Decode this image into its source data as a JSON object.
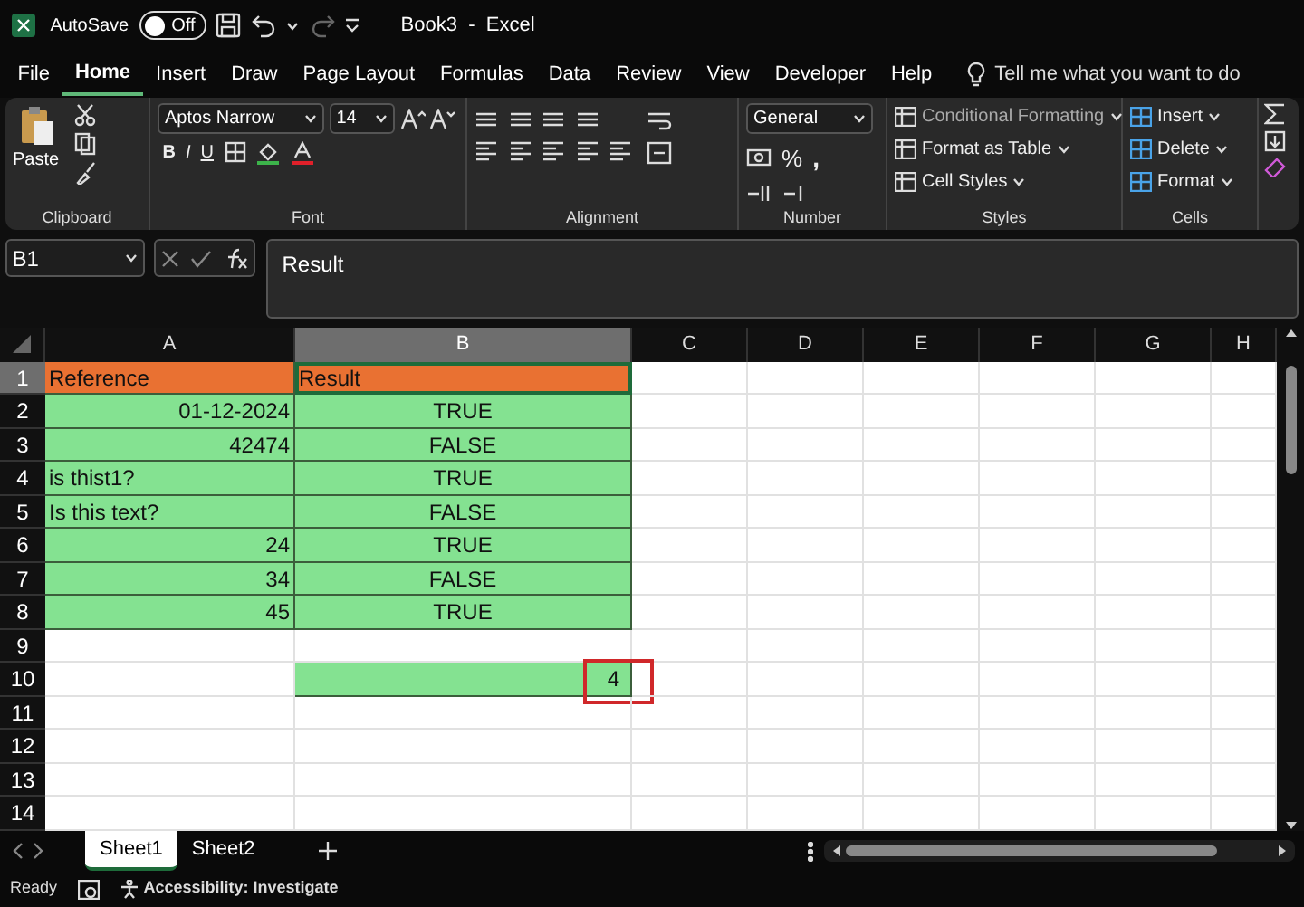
{
  "titlebar": {
    "autosave_label": "AutoSave",
    "autosave": {
      "on": false,
      "label": "Off"
    },
    "title": "Book3  -  Excel"
  },
  "menu": [
    {
      "label": "File",
      "selected": false
    },
    {
      "label": "Home",
      "selected": true
    },
    {
      "label": "Insert",
      "selected": false
    },
    {
      "label": "Draw",
      "selected": false
    },
    {
      "label": "Page Layout",
      "selected": false
    },
    {
      "label": "Formulas",
      "selected": false
    },
    {
      "label": "Data",
      "selected": false
    },
    {
      "label": "Review",
      "selected": false
    },
    {
      "label": "View",
      "selected": false
    },
    {
      "label": "Developer",
      "selected": false
    },
    {
      "label": "Help",
      "selected": false
    }
  ],
  "tell_me": "Tell me what you want to do",
  "ribbon": {
    "clipboard": {
      "paste": "Paste",
      "label": "Clipboard"
    },
    "font": {
      "name": "Aptos Narrow",
      "size": "14",
      "bold": "B",
      "italic": "I",
      "underline": "U",
      "label": "Font"
    },
    "alignment": {
      "label": "Alignment"
    },
    "number": {
      "format": "General",
      "percent": "%",
      "comma": ",",
      "label": "Number"
    },
    "styles": {
      "items": [
        "Conditional Formatting",
        "Format as Table",
        "Cell Styles"
      ],
      "label": "Styles"
    },
    "cells": {
      "items": [
        "Insert",
        "Delete",
        "Format"
      ],
      "label": "Cells"
    }
  },
  "name_box": "B1",
  "formula": "Result",
  "columns": [
    {
      "label": "A",
      "selected": false
    },
    {
      "label": "B",
      "selected": true
    },
    {
      "label": "C",
      "selected": false
    },
    {
      "label": "D",
      "selected": false
    },
    {
      "label": "E",
      "selected": false
    },
    {
      "label": "F",
      "selected": false
    },
    {
      "label": "G",
      "selected": false
    },
    {
      "label": "H",
      "selected": false
    }
  ],
  "rows": [
    {
      "label": "1",
      "selected": true,
      "cells": {
        "A": {
          "text": "Reference",
          "kind": "text",
          "color": "#e97132"
        },
        "B": {
          "text": "Result",
          "kind": "text",
          "color": "#e97132",
          "active": true
        }
      }
    },
    {
      "label": "2",
      "selected": false,
      "cells": {
        "A": {
          "text": "01-12-2024",
          "kind": "number",
          "color": "#84e291"
        },
        "B": {
          "text": "TRUE",
          "kind": "boolean",
          "color": "#84e291"
        }
      }
    },
    {
      "label": "3",
      "selected": false,
      "cells": {
        "A": {
          "text": "42474",
          "kind": "number",
          "color": "#84e291"
        },
        "B": {
          "text": "FALSE",
          "kind": "boolean",
          "color": "#84e291"
        }
      }
    },
    {
      "label": "4",
      "selected": false,
      "cells": {
        "A": {
          "text": "is thist1?",
          "kind": "text",
          "color": "#84e291"
        },
        "B": {
          "text": "TRUE",
          "kind": "boolean",
          "color": "#84e291"
        }
      }
    },
    {
      "label": "5",
      "selected": false,
      "cells": {
        "A": {
          "text": "Is this text?",
          "kind": "text",
          "color": "#84e291"
        },
        "B": {
          "text": "FALSE",
          "kind": "boolean",
          "color": "#84e291"
        }
      }
    },
    {
      "label": "6",
      "selected": false,
      "cells": {
        "A": {
          "text": "24",
          "kind": "number",
          "color": "#84e291"
        },
        "B": {
          "text": "TRUE",
          "kind": "boolean",
          "color": "#84e291"
        }
      }
    },
    {
      "label": "7",
      "selected": false,
      "cells": {
        "A": {
          "text": "34",
          "kind": "number",
          "color": "#84e291"
        },
        "B": {
          "text": "FALSE",
          "kind": "boolean",
          "color": "#84e291"
        }
      }
    },
    {
      "label": "8",
      "selected": false,
      "cells": {
        "A": {
          "text": "45",
          "kind": "number",
          "color": "#84e291"
        },
        "B": {
          "text": "TRUE",
          "kind": "boolean",
          "color": "#84e291"
        }
      }
    },
    {
      "label": "9",
      "selected": false
    },
    {
      "label": "10",
      "selected": false,
      "cells": {
        "B": {
          "text": "4",
          "kind": "number",
          "color": "#84e291",
          "outlined": true
        }
      }
    },
    {
      "label": "11",
      "selected": false
    },
    {
      "label": "12",
      "selected": false
    },
    {
      "label": "13",
      "selected": false
    },
    {
      "label": "14",
      "selected": false
    }
  ],
  "sheets": [
    {
      "label": "Sheet1",
      "selected": true
    },
    {
      "label": "Sheet2",
      "selected": false
    }
  ],
  "status": {
    "ready": "Ready",
    "accessibility": "Accessibility: Investigate"
  }
}
